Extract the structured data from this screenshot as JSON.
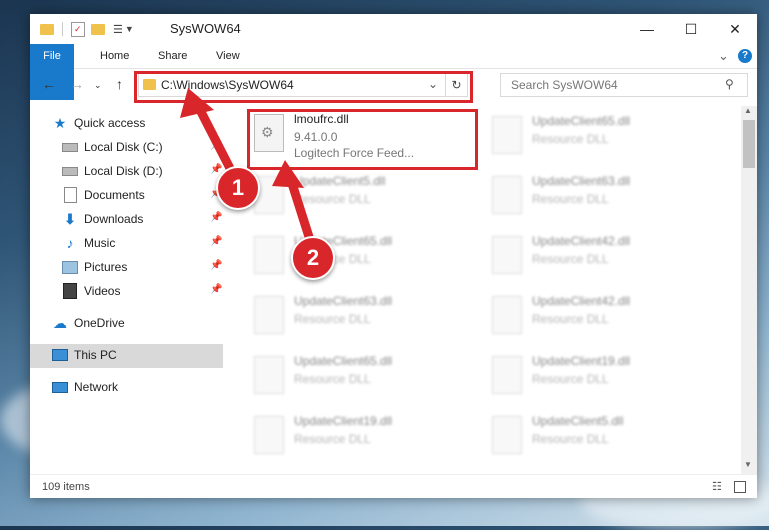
{
  "window": {
    "title": "SysWOW64",
    "minimize": "—",
    "maximize": "☐",
    "close": "✕"
  },
  "ribbon": {
    "tabs": [
      "File",
      "Home",
      "Share",
      "View"
    ],
    "help": "?",
    "expand": "⌄"
  },
  "address": {
    "path": "C:\\Windows\\SysWOW64",
    "search_placeholder": "Search SysWOW64"
  },
  "nav": {
    "items": [
      {
        "label": "Quick access",
        "icon": "star-icon"
      },
      {
        "label": "Local Disk (C:)",
        "icon": "drive-icon"
      },
      {
        "label": "Local Disk (D:)",
        "icon": "drive-icon"
      },
      {
        "label": "Documents",
        "icon": "documents-icon"
      },
      {
        "label": "Downloads",
        "icon": "download-icon"
      },
      {
        "label": "Music",
        "icon": "music-icon"
      },
      {
        "label": "Pictures",
        "icon": "pictures-icon"
      },
      {
        "label": "Videos",
        "icon": "videos-icon"
      },
      {
        "label": "OneDrive",
        "icon": "cloud-icon"
      },
      {
        "label": "This PC",
        "icon": "computer-icon"
      },
      {
        "label": "Network",
        "icon": "network-icon"
      }
    ]
  },
  "files": {
    "highlighted": {
      "name": "lmoufrc.dll",
      "version": "9.41.0.0",
      "description": "Logitech Force Feed..."
    },
    "left_column": [
      {
        "name": "UpdateClient5.dll",
        "type": "Resource DLL"
      },
      {
        "name": "UpdateClient65.dll",
        "type": "Resource DLL"
      },
      {
        "name": "UpdateClient63.dll",
        "type": "Resource DLL"
      },
      {
        "name": "UpdateClient65.dll",
        "type": "Resource DLL"
      },
      {
        "name": "UpdateClient19.dll",
        "type": "Resource DLL"
      }
    ],
    "right_column": [
      {
        "name": "UpdateClient65.dll",
        "type": "Resource DLL"
      },
      {
        "name": "UpdateClient63.dll",
        "type": "Resource DLL"
      },
      {
        "name": "UpdateClient42.dll",
        "type": "Resource DLL"
      },
      {
        "name": "UpdateClient42.dll",
        "type": "Resource DLL"
      },
      {
        "name": "UpdateClient19.dll",
        "type": "Resource DLL"
      },
      {
        "name": "UpdateClient5.dll",
        "type": "Resource DLL"
      }
    ]
  },
  "status": {
    "count": "109 items"
  },
  "annotations": {
    "step1": "1",
    "step2": "2",
    "color": "#d8262a"
  }
}
